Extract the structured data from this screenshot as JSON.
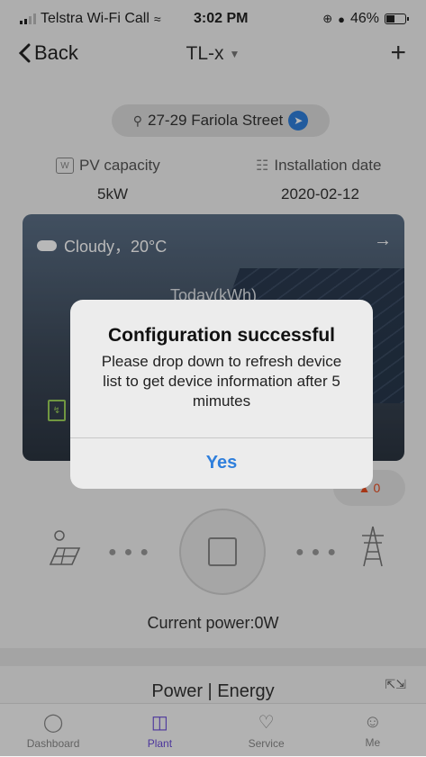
{
  "status_bar": {
    "carrier": "Telstra Wi-Fi Call",
    "time": "3:02 PM",
    "battery": "46%"
  },
  "nav": {
    "back_label": "Back",
    "title": "TL-x",
    "add_icon": "plus-icon"
  },
  "plant": {
    "address": "27-29 Fariola Street",
    "pv_capacity_label": "PV capacity",
    "pv_capacity_value": "5kW",
    "install_date_label": "Installation date",
    "install_date_value": "2020-02-12"
  },
  "weather_card": {
    "weather": "Cloudy，20°C",
    "today_label": "Today(kWh)"
  },
  "badge": {
    "value": "0"
  },
  "flow": {
    "current_power": "Current power:0W"
  },
  "section": {
    "title": "Power | Energy"
  },
  "tabs": [
    {
      "label": "Dashboard",
      "icon": "dashboard-icon"
    },
    {
      "label": "Plant",
      "icon": "plant-icon"
    },
    {
      "label": "Service",
      "icon": "service-icon"
    },
    {
      "label": "Me",
      "icon": "user-icon"
    }
  ],
  "dialog": {
    "title": "Configuration successful",
    "message": "Please drop down  to refresh device list to get device information after 5 mimutes",
    "confirm_label": "Yes"
  },
  "colors": {
    "accent": "#2f7fdc",
    "tab_active": "#6a4bd8",
    "badge_red": "#e84c1f"
  }
}
